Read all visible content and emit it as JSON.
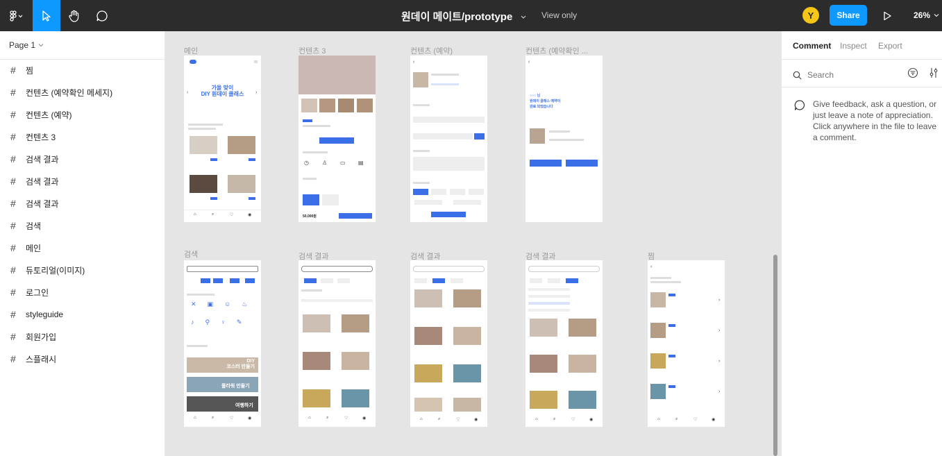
{
  "toolbar": {
    "file_name": "원데이 메이트/prototype",
    "view_mode": "View only",
    "user_initial": "Y",
    "share_label": "Share",
    "zoom": "26%"
  },
  "left_panel": {
    "page": "Page 1",
    "layers": [
      "찜",
      "컨텐츠 (예약확인 메세지)",
      "컨텐츠 (예약)",
      "컨텐츠 3",
      "검색 결과",
      "검색 결과",
      "검색 결과",
      "검색",
      "메인",
      "듀토리얼(이미지)",
      "로그인",
      "styleguide",
      "회원가입",
      "스플래시"
    ]
  },
  "canvas": {
    "frames": [
      {
        "label": "메인"
      },
      {
        "label": "컨텐츠 3"
      },
      {
        "label": "컨텐츠 (예약)"
      },
      {
        "label": "컨텐츠 (예약확인 ..."
      },
      {
        "label": "검색"
      },
      {
        "label": "검색 결과"
      },
      {
        "label": "검색 결과"
      },
      {
        "label": "검색 결과"
      },
      {
        "label": "찜"
      }
    ],
    "main_hero": "가을 맞이\nDIY 원데이 클래스",
    "confirm_text": "○○○ 님\n원데이 클래스 예약이\n완료 되었습니다",
    "search_banner_1": "DIY\n코스터 만들기",
    "search_banner_2": "플라워 만들기",
    "search_banner_3": "여행하기",
    "price": "50,000원"
  },
  "right_panel": {
    "tabs": [
      "Comment",
      "Inspect",
      "Export"
    ],
    "search_placeholder": "Search",
    "hint": "Give feedback, ask a question, or just leave a note of appreciation. Click anywhere in the file to leave a comment."
  },
  "colors": {
    "toolbar_bg": "#2c2c2c",
    "accent": "#0d99ff",
    "frame_primary": "#3b6fe8",
    "avatar": "#f5c518"
  }
}
